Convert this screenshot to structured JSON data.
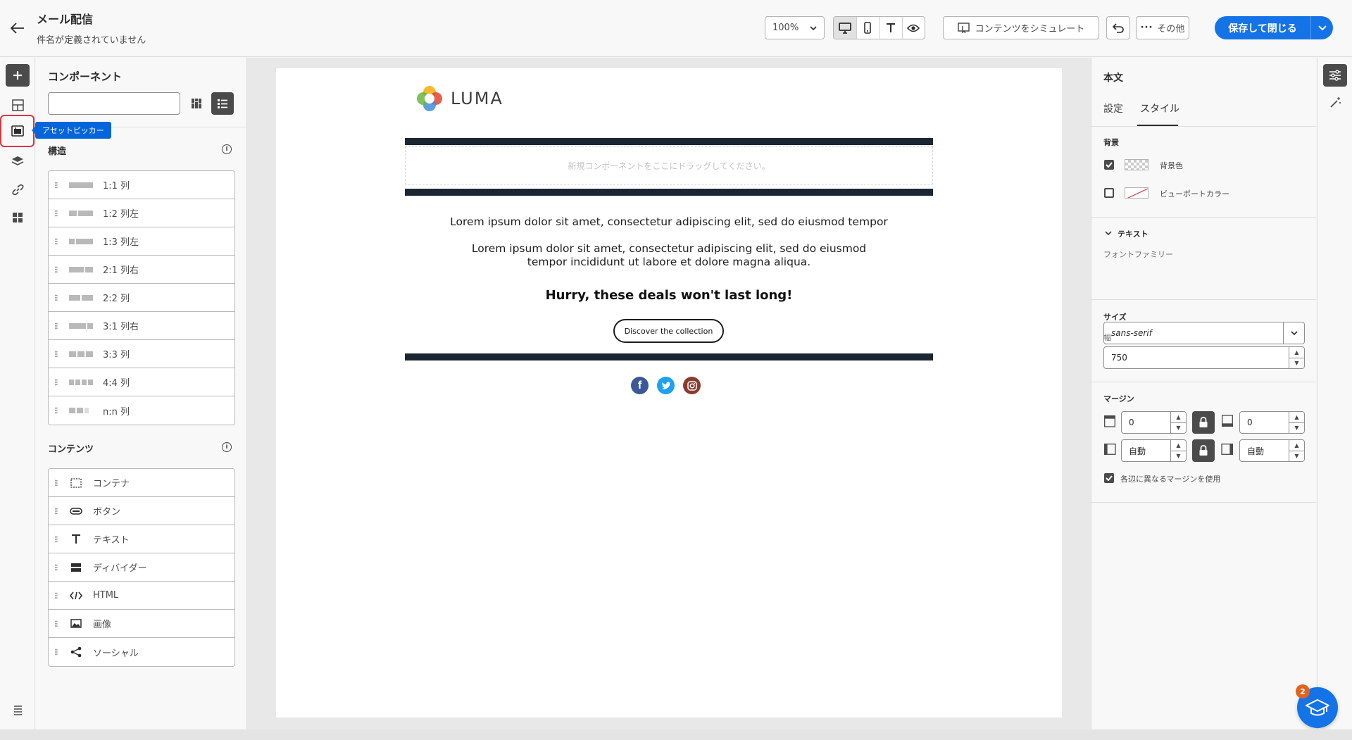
{
  "header": {
    "title": "メール配信",
    "subtitle": "件名が定義されていません",
    "zoom": "100%",
    "simulate_label": "コンテンツをシミュレート",
    "more_label": "その他",
    "save_label": "保存して閉じる"
  },
  "rail": {
    "tooltip": "アセットピッカー"
  },
  "components": {
    "title": "コンポーネント",
    "search_placeholder": "",
    "structure_title": "構造",
    "structure_items": [
      {
        "label": "1:1 列"
      },
      {
        "label": "1:2 列左"
      },
      {
        "label": "1:3 列左"
      },
      {
        "label": "2:1 列右"
      },
      {
        "label": "2:2 列"
      },
      {
        "label": "3:1 列右"
      },
      {
        "label": "3:3 列"
      },
      {
        "label": "4:4 列"
      },
      {
        "label": "n:n 列"
      }
    ],
    "content_title": "コンテンツ",
    "content_items": [
      {
        "label": "コンテナ",
        "icon": "container-icon"
      },
      {
        "label": "ボタン",
        "icon": "button-icon"
      },
      {
        "label": "テキスト",
        "icon": "text-icon"
      },
      {
        "label": "ディバイダー",
        "icon": "divider-icon"
      },
      {
        "label": "HTML",
        "icon": "code-icon"
      },
      {
        "label": "画像",
        "icon": "image-icon"
      },
      {
        "label": "ソーシャル",
        "icon": "share-icon"
      }
    ]
  },
  "email": {
    "logo_text": "LUMA",
    "drop_zone": "新規コンポーネントをここにドラッグしてください。",
    "para1": "Lorem ipsum dolor sit amet, consectetur adipiscing elit, sed do eiusmod tempor",
    "para2": "Lorem ipsum dolor sit amet, consectetur adipiscing elit, sed do eiusmod tempor incididunt ut labore et dolore magna aliqua.",
    "headline": "Hurry, these deals won't last long!",
    "cta": "Discover the collection",
    "social": [
      "facebook-icon",
      "twitter-icon",
      "instagram-icon"
    ]
  },
  "properties": {
    "title": "本文",
    "tabs": [
      "設定",
      "スタイル"
    ],
    "active_tab": "スタイル",
    "background": {
      "label": "背景",
      "bg_color_label": "背景色",
      "bg_color_checked": true,
      "viewport_label": "ビューポートカラー",
      "viewport_checked": false
    },
    "text": {
      "label": "テキスト",
      "font_family_label": "フォントファミリー",
      "font_family": "sans-serif"
    },
    "size": {
      "label": "サイズ",
      "width_label": "幅",
      "width": "750"
    },
    "margin": {
      "label": "マージン",
      "top": "0",
      "bottom": "0",
      "left": "自動",
      "right": "自動",
      "different_sides_label": "各辺に異なるマージンを使用",
      "different_sides_checked": true
    }
  },
  "help": {
    "badge": "2"
  },
  "colors": {
    "accent": "#1473e6",
    "dark_bar": "#1b2633",
    "tooltip": "#0265dc",
    "highlight": "#d7373f"
  }
}
